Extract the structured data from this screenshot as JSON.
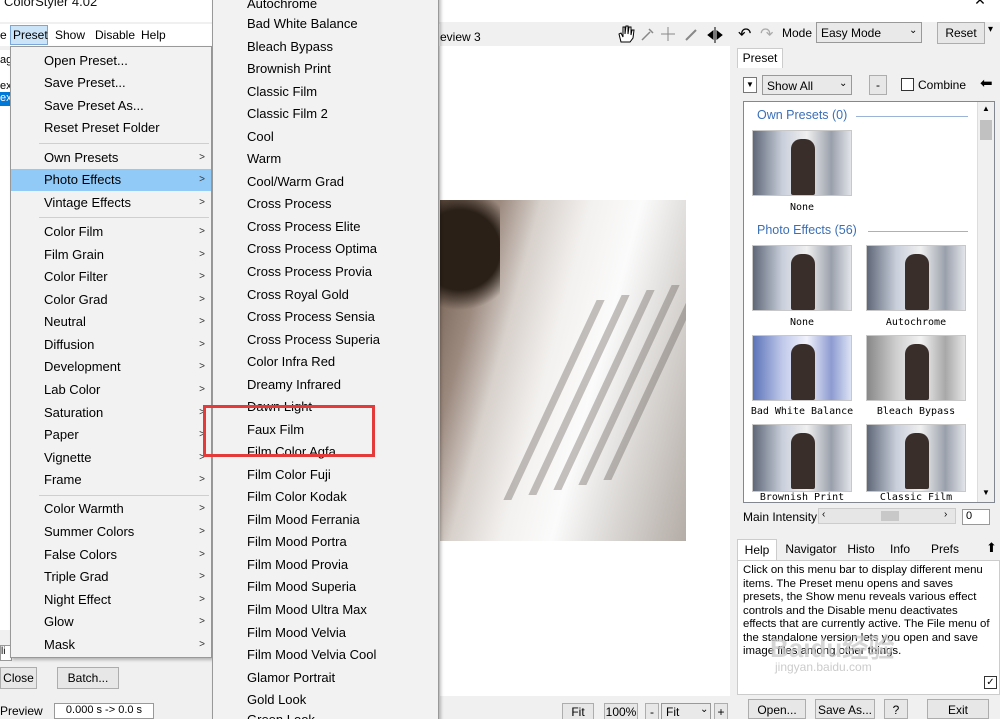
{
  "window": {
    "title": "ColorStyler 4.02",
    "minimize": "—",
    "close": "✕"
  },
  "menubar": {
    "left_partial": "e",
    "items": [
      "Preset",
      "Show",
      "Disable",
      "Help"
    ]
  },
  "left_panel": {
    "list_items": [
      "ag",
      "ex",
      "ex"
    ],
    "close_label": "Close",
    "batch_label": "Batch...",
    "preview_label": "Preview",
    "timing": "0.000 s -> 0.0 s",
    "check_partial": "li"
  },
  "preview": {
    "tab_label": "eview 3"
  },
  "toolbar": {
    "mode_label": "Mode",
    "mode_value": "Easy Mode",
    "reset_label": "Reset"
  },
  "preset_panel": {
    "tab": "Preset",
    "show_value": "Show All",
    "minus": "-",
    "combine_label": "Combine",
    "own_presets_header": "Own Presets (0)",
    "photo_effects_header": "Photo Effects (56)",
    "own_thumbs": [
      "None"
    ],
    "photo_thumbs": [
      "None",
      "Autochrome",
      "Bad White Balance",
      "Bleach Bypass",
      "Brownish Print",
      "Classic Film"
    ],
    "intensity_label": "Main Intensity",
    "intensity_value": "0",
    "intensity_level": 0.5
  },
  "help_panel": {
    "tabs": [
      "Help",
      "Navigator",
      "Histo",
      "Info",
      "Prefs"
    ],
    "text": "Click on this menu bar to display different menu items. The Preset menu opens and saves presets, the Show menu reveals various effect controls and the Disable menu deactivates effects that are currently active. The File menu of the standalone version lets you open and save image files among other things."
  },
  "bottom_bar": {
    "fit1": "Fit",
    "zoom": "100%",
    "minus": "-",
    "fit2": "Fit",
    "plus": "+",
    "open_label": "Open...",
    "saveas_label": "Save As...",
    "help_q": "?",
    "exit_label": "Exit"
  },
  "preset_menu": {
    "items": [
      "Open Preset...",
      "Save Preset...",
      "Save Preset As...",
      "Reset Preset Folder",
      "Own Presets",
      "Photo Effects",
      "Vintage Effects",
      "Color Film",
      "Film Grain",
      "Color Filter",
      "Color Grad",
      "Neutral",
      "Diffusion",
      "Development",
      "Lab Color",
      "Saturation",
      "Paper",
      "Vignette",
      "Frame",
      "Color Warmth",
      "Summer Colors",
      "False Colors",
      "Triple Grad",
      "Night Effect",
      "Glow",
      "Mask"
    ],
    "highlighted": "Photo Effects"
  },
  "photo_effects_submenu": {
    "items": [
      "Autochrome",
      "Bad White Balance",
      "Bleach Bypass",
      "Brownish Print",
      "Classic Film",
      "Classic Film 2",
      "Cool",
      "Warm",
      "Cool/Warm Grad",
      "Cross Process",
      "Cross Process Elite",
      "Cross Process Optima",
      "Cross Process Provia",
      "Cross Royal Gold",
      "Cross Process Sensia",
      "Cross Process Superia",
      "Color Infra Red",
      "Dreamy Infrared",
      "Dawn Light",
      "Faux Film",
      "Film Color Agfa",
      "Film Color Fuji",
      "Film Color Kodak",
      "Film Mood Ferrania",
      "Film Mood Portra",
      "Film Mood Provia",
      "Film Mood Superia",
      "Film Mood Ultra Max",
      "Film Mood Velvia",
      "Film Mood Velvia Cool",
      "Glamor Portrait",
      "Gold Look",
      "Green Look"
    ]
  },
  "watermark": {
    "brand": "Baidu经验",
    "url": "jingyan.baidu.com"
  },
  "colors": {
    "highlight": "#91c9f7",
    "annotation": "#e53a3a",
    "section_blue": "#3b6fb6"
  }
}
